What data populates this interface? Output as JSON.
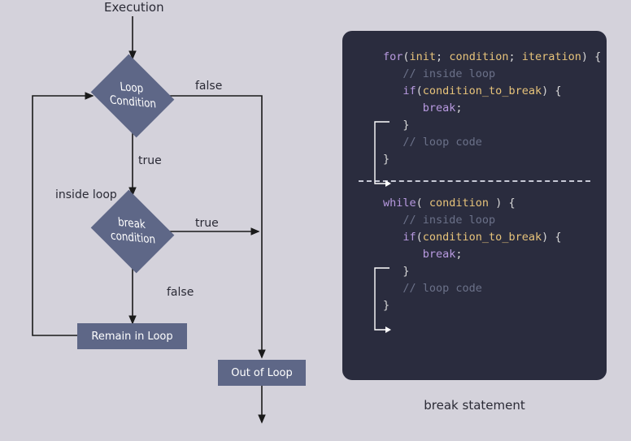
{
  "flowchart": {
    "start": "Execution",
    "loop_condition": "Loop\nCondition",
    "branch_false": "false",
    "branch_true": "true",
    "inside_loop": "inside loop",
    "break_condition": "break\ncondition",
    "break_true": "true",
    "break_false": "false",
    "remain": "Remain in Loop",
    "out": "Out of Loop"
  },
  "code": {
    "for": {
      "l1_for": "for",
      "l1_open": "(",
      "l1_init": "init",
      "l1_sep1": "; ",
      "l1_cond": "condition",
      "l1_sep2": "; ",
      "l1_iter": "iteration",
      "l1_close": ") {",
      "l2": "   // inside loop",
      "l3": "",
      "l4_if": "   if",
      "l4_open": "(",
      "l4_cond": "condition_to_break",
      "l4_close": ") {",
      "l5_break": "      break",
      "l5_semi": ";",
      "l6": "   }",
      "l7": "   // loop code",
      "l8": "}"
    },
    "while": {
      "l1_while": "while",
      "l1_open": "( ",
      "l1_cond": "condition",
      "l1_close": " ) {",
      "l2": "   // inside loop",
      "l3": "",
      "l4_if": "   if",
      "l4_open": "(",
      "l4_cond": "condition_to_break",
      "l4_close": ") {",
      "l5_break": "      break",
      "l5_semi": ";",
      "l6": "   }",
      "l7": "   // loop code",
      "l8": "}"
    }
  },
  "caption": "break statement"
}
